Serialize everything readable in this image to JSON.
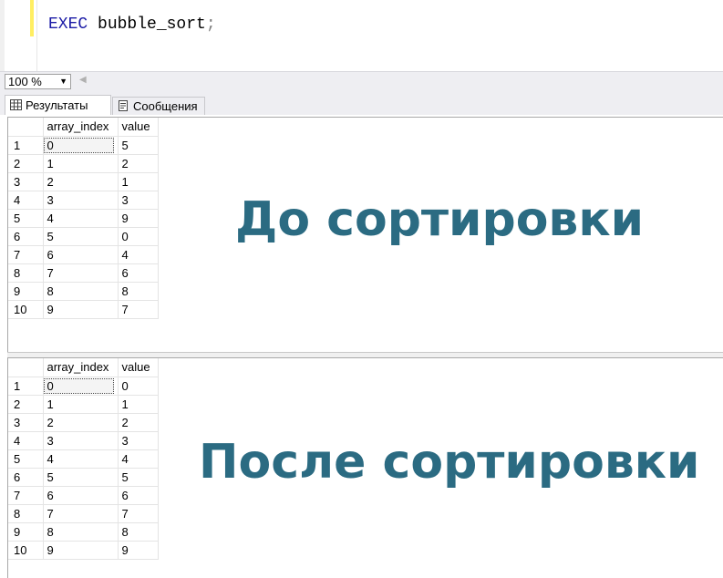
{
  "editor": {
    "code_keyword": "EXEC",
    "code_rest": " bubble_sort",
    "code_punct": ";"
  },
  "toolbar": {
    "zoom_value": "100 %"
  },
  "tabs": [
    {
      "label": "Результаты",
      "icon": "grid-icon"
    },
    {
      "label": "Сообщения",
      "icon": "message-icon"
    }
  ],
  "grid1": {
    "columns": [
      "array_index",
      "value"
    ],
    "rows": [
      {
        "n": "1",
        "array_index": "0",
        "value": "5"
      },
      {
        "n": "2",
        "array_index": "1",
        "value": "2"
      },
      {
        "n": "3",
        "array_index": "2",
        "value": "1"
      },
      {
        "n": "4",
        "array_index": "3",
        "value": "3"
      },
      {
        "n": "5",
        "array_index": "4",
        "value": "9"
      },
      {
        "n": "6",
        "array_index": "5",
        "value": "0"
      },
      {
        "n": "7",
        "array_index": "6",
        "value": "4"
      },
      {
        "n": "8",
        "array_index": "7",
        "value": "6"
      },
      {
        "n": "9",
        "array_index": "8",
        "value": "8"
      },
      {
        "n": "10",
        "array_index": "9",
        "value": "7"
      }
    ]
  },
  "grid2": {
    "columns": [
      "array_index",
      "value"
    ],
    "rows": [
      {
        "n": "1",
        "array_index": "0",
        "value": "0"
      },
      {
        "n": "2",
        "array_index": "1",
        "value": "1"
      },
      {
        "n": "3",
        "array_index": "2",
        "value": "2"
      },
      {
        "n": "4",
        "array_index": "3",
        "value": "3"
      },
      {
        "n": "5",
        "array_index": "4",
        "value": "4"
      },
      {
        "n": "6",
        "array_index": "5",
        "value": "5"
      },
      {
        "n": "7",
        "array_index": "6",
        "value": "6"
      },
      {
        "n": "8",
        "array_index": "7",
        "value": "7"
      },
      {
        "n": "9",
        "array_index": "8",
        "value": "8"
      },
      {
        "n": "10",
        "array_index": "9",
        "value": "9"
      }
    ]
  },
  "captions": {
    "before": "До сортировки",
    "after": "После сортировки"
  },
  "colors": {
    "caption": "#2b6b82",
    "keyword": "#1a1aa6"
  }
}
